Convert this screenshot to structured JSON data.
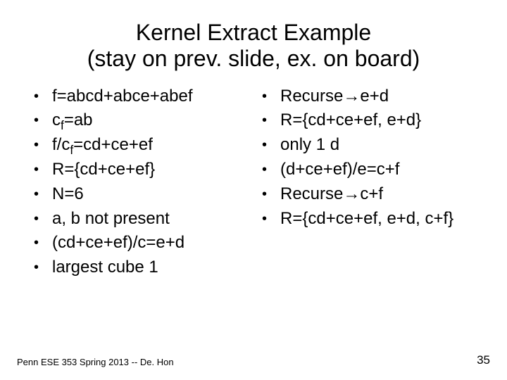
{
  "title_line1": "Kernel Extract Example",
  "title_line2": "(stay on prev. slide, ex. on board)",
  "left": [
    {
      "pre": "f=abcd+abce+abef"
    },
    {
      "pre": "c",
      "sub": "f",
      "post": "=ab"
    },
    {
      "pre": "f/c",
      "sub": "f",
      "post": "=cd+ce+ef"
    },
    {
      "pre": "R={cd+ce+ef}"
    },
    {
      "pre": "N=6"
    },
    {
      "pre": "a, b not present"
    },
    {
      "pre": "(cd+ce+ef)/c=e+d"
    },
    {
      "pre": "largest cube 1"
    }
  ],
  "right": [
    {
      "pre": "Recurse",
      "arrow": "→",
      "post": "e+d"
    },
    {
      "pre": "R={cd+ce+ef, e+d}"
    },
    {
      "pre": "only 1 d"
    },
    {
      "pre": "(d+ce+ef)/e=c+f"
    },
    {
      "pre": "Recurse",
      "arrow": "→",
      "post": "c+f"
    },
    {
      "pre": "R={cd+ce+ef, e+d, c+f}"
    }
  ],
  "footer_left": "Penn ESE 353 Spring 2013 -- De. Hon",
  "footer_right": "35"
}
